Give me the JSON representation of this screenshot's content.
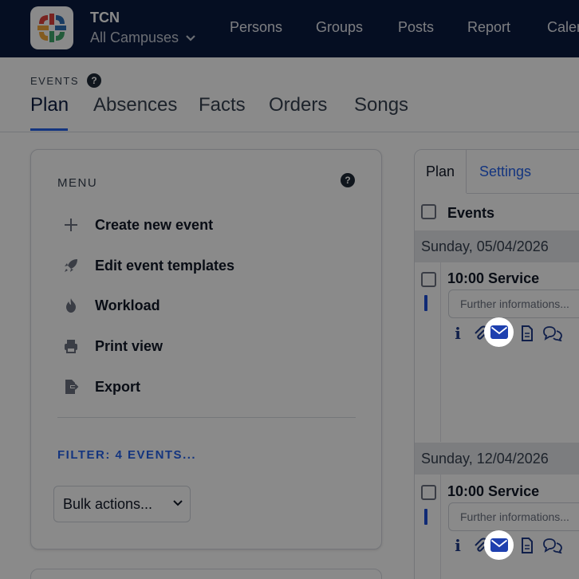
{
  "brand": {
    "org_name": "TCN",
    "campus": "All Campuses",
    "logo_colors": [
      "#e0413b",
      "#f2a93b",
      "#3fa86b",
      "#2d6fb5"
    ]
  },
  "nav": {
    "items": [
      "Persons",
      "Groups",
      "Posts",
      "Report",
      "Calen"
    ]
  },
  "page": {
    "section": "EVENTS",
    "help": "?",
    "tabs": [
      "Plan",
      "Absences",
      "Facts",
      "Orders",
      "Songs"
    ],
    "active_tab": "Plan"
  },
  "menu": {
    "title": "MENU",
    "help": "?",
    "items": [
      {
        "label": "Create new event",
        "icon": "plus-icon"
      },
      {
        "label": "Edit event templates",
        "icon": "rocket-icon"
      },
      {
        "label": "Workload",
        "icon": "flame-icon"
      },
      {
        "label": "Print view",
        "icon": "printer-icon"
      },
      {
        "label": "Export",
        "icon": "export-icon"
      }
    ],
    "filter_link": "FILTER: 4 EVENTS...",
    "bulk_actions": "Bulk actions..."
  },
  "plan_panel": {
    "tabs": [
      "Plan",
      "Settings"
    ],
    "active_tab": "Plan",
    "events_header": "Events",
    "groups": [
      {
        "date": "Sunday, 05/04/2026",
        "event_title": "10:00 Service",
        "input_placeholder": "Further informations..."
      },
      {
        "date": "Sunday, 12/04/2026",
        "event_title": "10:00 Service",
        "input_placeholder": "Further informations..."
      }
    ],
    "row_icons": [
      "info-icon",
      "paperclip-icon",
      "envelope-icon",
      "document-icon",
      "comments-icon"
    ],
    "info_glyph": "i"
  },
  "colors": {
    "nav_bg": "#0b1a3f",
    "accent": "#2563eb",
    "overlay": "rgba(0,0,0,0.46)"
  }
}
